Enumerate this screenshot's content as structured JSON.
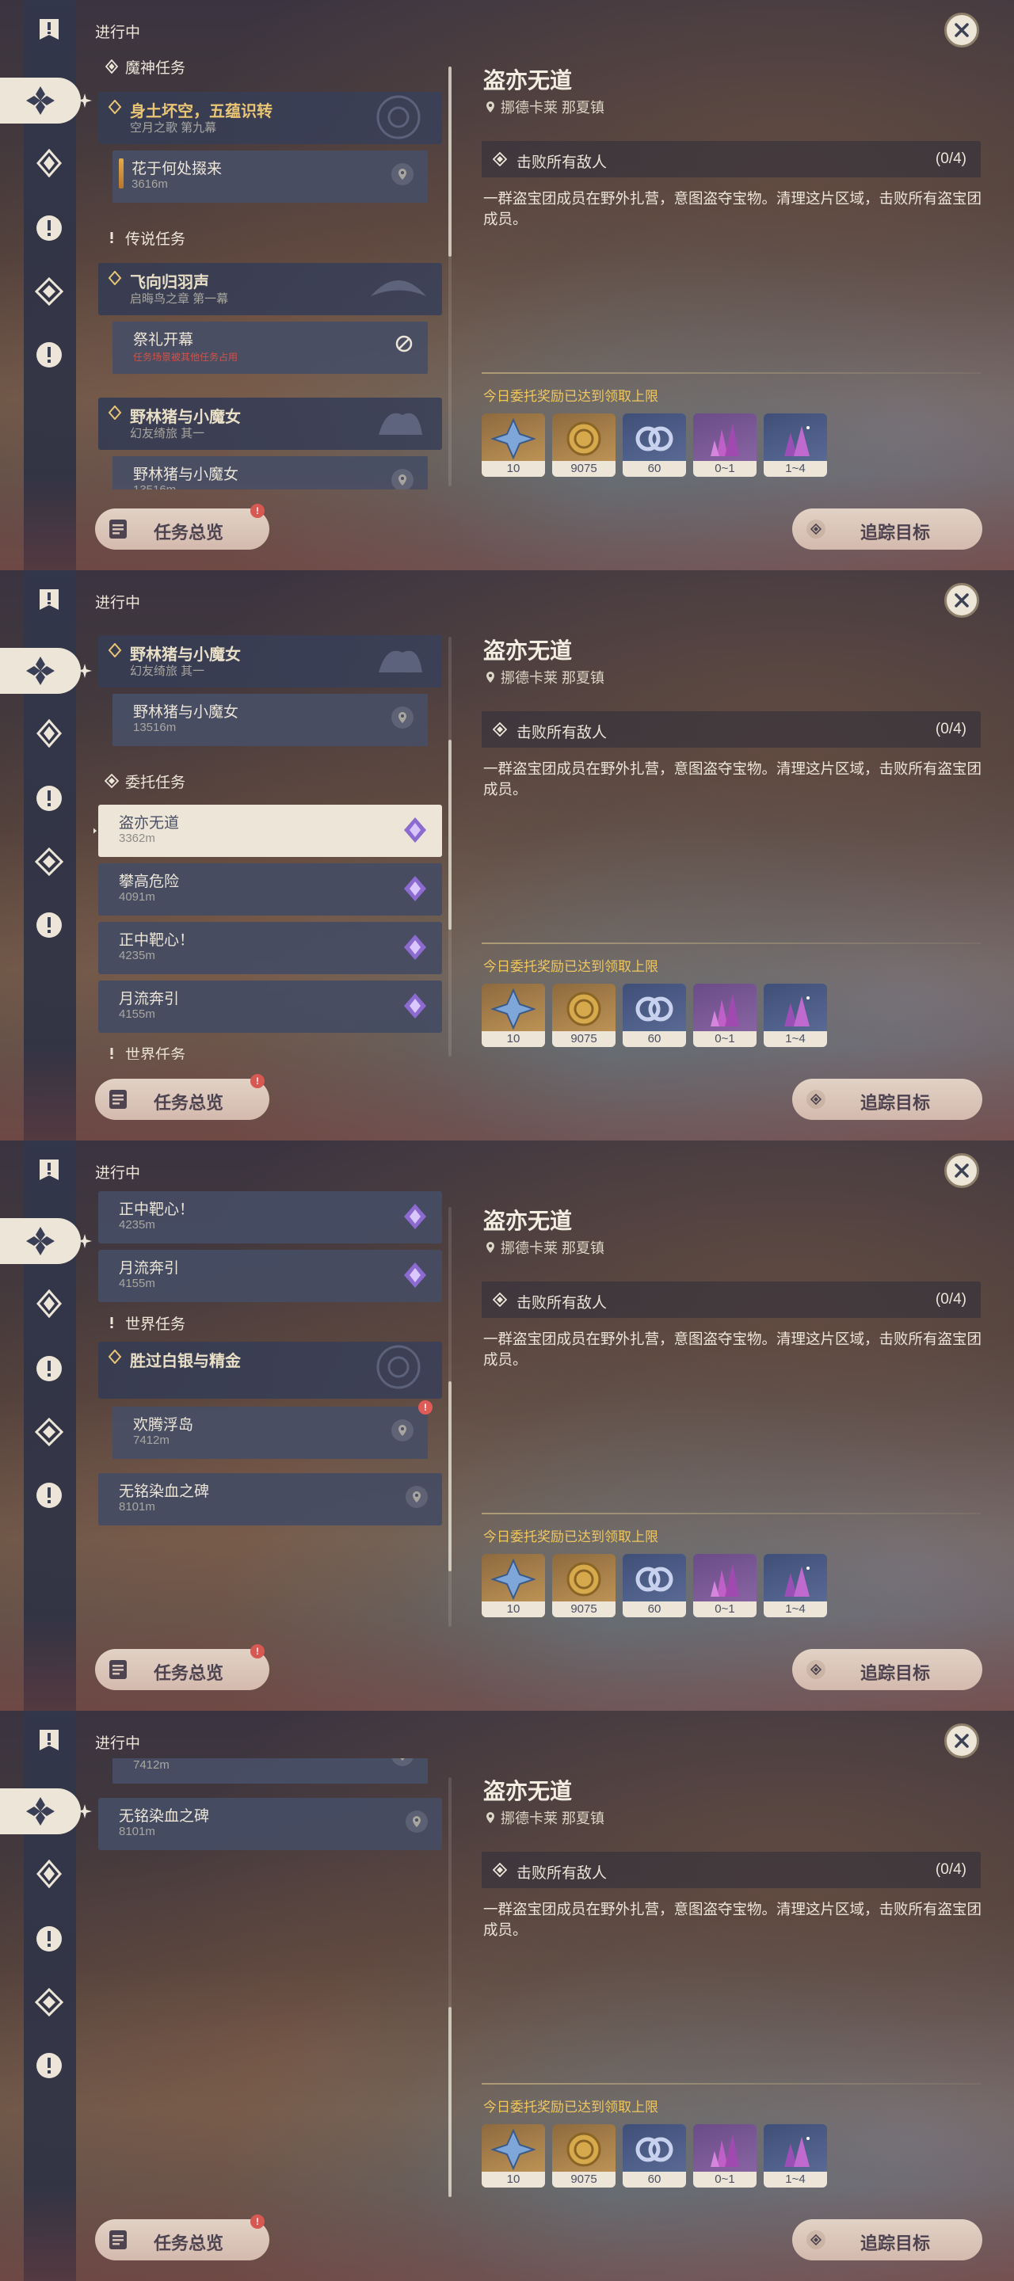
{
  "status_label": "进行中",
  "close_icon": "close-icon",
  "overview_button": "任务总览",
  "track_button": "追踪目标",
  "detail": {
    "title": "盗亦无道",
    "location": "挪德卡莱 那夏镇",
    "objective": "击败所有敌人",
    "objective_count": "(0/4)",
    "description": "一群盗宝团成员在野外扎营，意图盗夺宝物。清理这片区域，击败所有盗宝团成员。",
    "reward_heading": "今日委托奖励已达到领取上限",
    "rewards": [
      {
        "icon": "adventure-exp-icon",
        "count": "10",
        "style": "gold"
      },
      {
        "icon": "mora-coin-icon",
        "count": "9075",
        "style": "gold"
      },
      {
        "icon": "friendship-exp-icon",
        "count": "60",
        "style": "blue"
      },
      {
        "icon": "purple-crystal-icon",
        "count": "0~1",
        "style": "purp"
      },
      {
        "icon": "purple-crystal-cluster-icon",
        "count": "1~4",
        "style": "blue"
      }
    ]
  },
  "list_text": {
    "archon_section": "魔神任务",
    "legend_section": "传说任务",
    "commission_section": "委托任务",
    "world_section": "世界任务",
    "q1_title": "身土坏空，五蕴识转",
    "q1_sub": "空月之歌 第九幕",
    "q1_step": "花于何处掇来",
    "q1_step_dist": "3616m",
    "q2_title": "飞向归羽声",
    "q2_sub": "启晦鸟之章 第一幕",
    "q2_step": "祭礼开幕",
    "q2_step_warn": "任务场景被其他任务占用",
    "q3_title": "野林猪与小魔女",
    "q3_sub": "幻友绮旅 其一",
    "q3_step": "野林猪与小魔女",
    "q3_step_dist": "13516m",
    "c1": "盗亦无道",
    "c1_dist": "3362m",
    "c2": "攀高危险",
    "c2_dist": "4091m",
    "c3": "正中靶心！",
    "c3_dist": "4235m",
    "c4": "月流奔引",
    "c4_dist": "4155m",
    "w1_title": "胜过白银与精金",
    "w1_step": "欢腾浮岛",
    "w1_step_dist": "7412m",
    "w2": "无铭染血之碑",
    "w2_dist": "8101m"
  },
  "frames": [
    {
      "scroll": 0,
      "thumb": 0
    },
    {
      "scroll": 420,
      "thumb": 130
    },
    {
      "scroll": 800,
      "thumb": 220
    },
    {
      "scroll": 1110,
      "thumb": 290
    }
  ]
}
